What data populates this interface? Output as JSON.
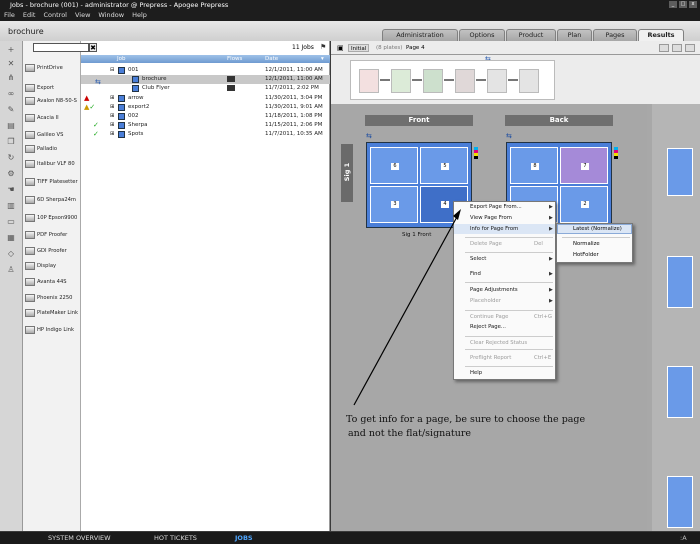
{
  "window": {
    "title": "Jobs - brochure (001) - administrator @ Prepress - Apogee Prepress"
  },
  "menu": [
    "File",
    "Edit",
    "Control",
    "View",
    "Window",
    "Help"
  ],
  "job_title": "brochure",
  "tabs": [
    "Administration",
    "Options",
    "Product",
    "Plan",
    "Pages",
    "Results"
  ],
  "active_tab": "Results",
  "search": {
    "value": "",
    "clear": "✖"
  },
  "job_count": "11 Jobs",
  "columns": {
    "job": "Job",
    "flows": "Flows",
    "date": "Date"
  },
  "devices": [
    "PrintDrive",
    "Export",
    "Avalon N8-50-S",
    "Acacia II",
    "Galileo VS",
    "Palladio",
    "Italibur VLF 80",
    "TIFF Platesetter",
    "6D Sherpa24m",
    "10P Epson9900",
    "PDF Proofer",
    "GDI Proofer",
    "Display",
    "Avanta 44S",
    "Phoenix 2250",
    "PlateMaker Link",
    "HP Indigo Link"
  ],
  "jobs": [
    {
      "name": "001",
      "date": "12/1/2011, 11:00 AM",
      "expand": "⊟",
      "status": ""
    },
    {
      "name": "brochure",
      "date": "12/1/2011, 11:00 AM",
      "expand": "",
      "status": ""
    },
    {
      "name": "Club Flyer",
      "date": "11/7/2011, 2:02 PM",
      "expand": "",
      "status": ""
    },
    {
      "name": "arrow",
      "date": "11/30/2011, 3:04 PM",
      "expand": "⊞",
      "status": "error"
    },
    {
      "name": "export2",
      "date": "11/30/2011, 9:01 AM",
      "expand": "⊞",
      "status": "warning-check"
    },
    {
      "name": "002",
      "date": "11/18/2011, 1:08 PM",
      "expand": "⊞",
      "status": ""
    },
    {
      "name": "Sherpa",
      "date": "11/15/2011, 2:06 PM",
      "expand": "⊞",
      "status": "check"
    },
    {
      "name": "Spots",
      "date": "11/7/2011, 10:35 AM",
      "expand": "⊞",
      "status": "check"
    }
  ],
  "results": {
    "view": "Initial",
    "plates": "(8 plates)",
    "page": "Page 4"
  },
  "sheet_headers": {
    "front": "Front",
    "back": "Back"
  },
  "signature_label": "Sig 1",
  "sheet_caption": "Sig 1 Front",
  "front_pages": [
    "6",
    "5",
    "3",
    "4"
  ],
  "back_pages": [
    "8",
    "7",
    "1",
    "2"
  ],
  "context_menu": [
    {
      "label": "Export Page From...",
      "shortcut": "",
      "submenu": true,
      "disabled": false
    },
    {
      "label": "View Page From",
      "shortcut": "",
      "submenu": true,
      "disabled": false
    },
    {
      "label": "Info for Page From",
      "shortcut": "",
      "submenu": true,
      "disabled": false,
      "highlight": true
    },
    {
      "label": "Delete Page",
      "shortcut": "Del",
      "submenu": false,
      "disabled": true
    },
    {
      "label": "Select",
      "shortcut": "",
      "submenu": true,
      "disabled": false
    },
    {
      "label": "Find",
      "shortcut": "",
      "submenu": true,
      "disabled": false
    },
    {
      "label": "Page Adjustments",
      "shortcut": "",
      "submenu": true,
      "disabled": false
    },
    {
      "label": "Placeholder",
      "shortcut": "",
      "submenu": true,
      "disabled": true
    },
    {
      "label": "Continue Page",
      "shortcut": "Ctrl+G",
      "submenu": false,
      "disabled": true
    },
    {
      "label": "Reject Page...",
      "shortcut": "",
      "submenu": false,
      "disabled": false
    },
    {
      "label": "Clear Rejected Status",
      "shortcut": "",
      "submenu": false,
      "disabled": true
    },
    {
      "label": "Preflight Report",
      "shortcut": "Ctrl+E",
      "submenu": false,
      "disabled": true
    },
    {
      "label": "Help",
      "shortcut": "",
      "submenu": false,
      "disabled": false
    }
  ],
  "submenu": [
    "Latest (Normalize)",
    "Normalize",
    "HotFolder"
  ],
  "annotation": {
    "line1": "To get info for a page, be sure to choose the page",
    "line2": "and not the flat/signature"
  },
  "bottom_tabs": [
    "SYSTEM OVERVIEW",
    "HOT TICKETS",
    "JOBS"
  ],
  "bottom_right": ":A",
  "colors": {
    "page_blue": "#6a9ae8",
    "sheet_blue": "#4a7ed8",
    "header_blue": "#7ea6d8",
    "bottom_active": "#4ea6ff"
  }
}
